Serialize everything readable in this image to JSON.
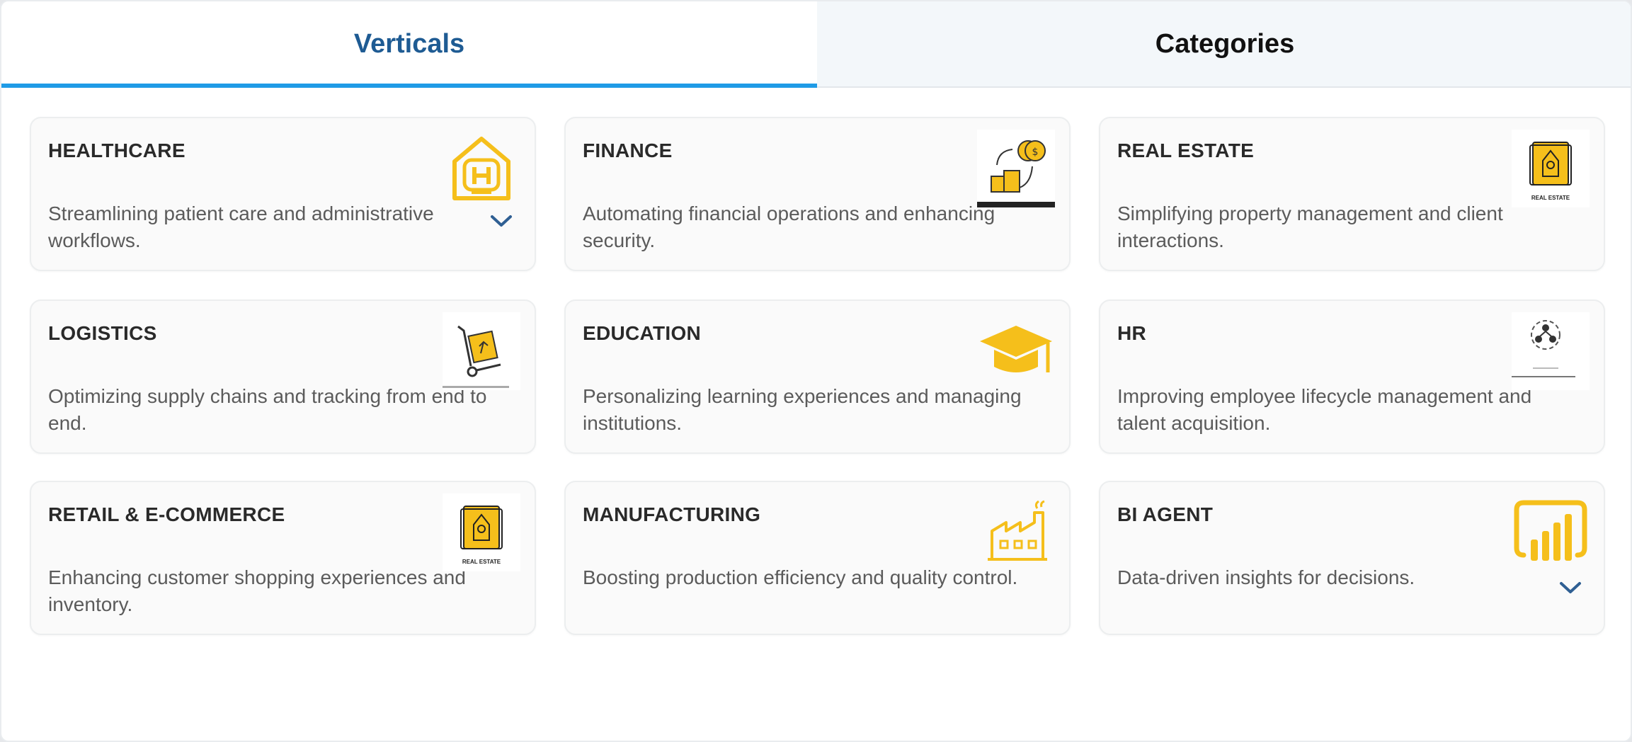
{
  "tabs": [
    {
      "label": "Verticals",
      "active": true
    },
    {
      "label": "Categories",
      "active": false
    }
  ],
  "cards": [
    {
      "title": "HEALTHCARE",
      "description": "Streamlining patient care and administrative workflows.",
      "icon": "hospital-icon",
      "expand": true
    },
    {
      "title": "FINANCE",
      "description": "Automating financial operations and enhancing security.",
      "icon": "coins-exchange-icon",
      "expand": false
    },
    {
      "title": "REAL ESTATE",
      "description": "Simplifying property management and client interactions.",
      "icon": "real-estate-icon",
      "icon_caption": "REAL ESTATE",
      "expand": false
    },
    {
      "title": "LOGISTICS",
      "description": "Optimizing supply chains and tracking from end to end.",
      "icon": "hand-truck-icon",
      "expand": false
    },
    {
      "title": "EDUCATION",
      "description": "Personalizing learning experiences and managing institutions.",
      "icon": "graduation-cap-icon",
      "expand": false
    },
    {
      "title": "HR",
      "description": "Improving employee lifecycle management and talent acquisition.",
      "icon": "team-network-icon",
      "expand": false
    },
    {
      "title": "RETAIL & E-COMMERCE",
      "description": "Enhancing customer shopping experiences and inventory.",
      "icon": "real-estate-icon",
      "icon_caption": "REAL ESTATE",
      "expand": false
    },
    {
      "title": "MANUFACTURING",
      "description": "Boosting production efficiency and quality control.",
      "icon": "factory-icon",
      "expand": false
    },
    {
      "title": "BI AGENT",
      "description": "Data-driven insights for decisions.",
      "icon": "bar-chart-icon",
      "expand": true
    }
  ],
  "colors": {
    "accent_text": "#1e5b93",
    "tab_underline": "#1f9be6",
    "icon_yellow": "#f5bf1b",
    "chevron": "#2f5f93"
  }
}
